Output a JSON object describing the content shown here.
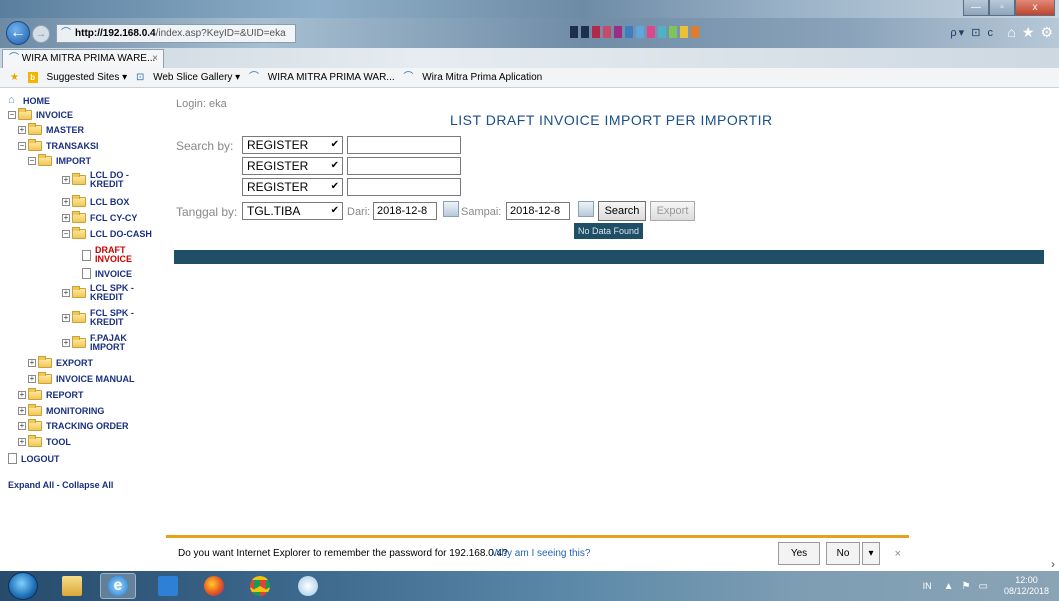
{
  "browser": {
    "url_host": "http://192.168.0.4",
    "url_path": "/index.asp?KeyID=&UID=eka",
    "search_icons": "ρ▾ ⊡ c",
    "tab_title": "WIRA MITRA PRIMA WARE...",
    "tab_close": "×",
    "win_min": "—",
    "win_max": "▫",
    "win_close": "x",
    "favorites": {
      "suggested": "Suggested Sites ▾",
      "web_slice": "Web Slice Gallery ▾",
      "fav1": "WIRA MITRA PRIMA WAR...",
      "fav2": "Wira Mitra Prima Aplication"
    }
  },
  "sidebar": {
    "home": "HOME",
    "invoice": "INVOICE",
    "master": "MASTER",
    "transaksi": "TRANSAKSI",
    "import": "IMPORT",
    "lcl_do_kredit_1": "LCL DO -",
    "lcl_do_kredit_2": "KREDIT",
    "lcl_box": "LCL BOX",
    "fcl_cy_cy": "FCL CY-CY",
    "lcl_do_cash": "LCL DO-CASH",
    "draft_invoice_1": "DRAFT",
    "draft_invoice_2": "INVOICE",
    "invoice_leaf": "INVOICE",
    "lcl_spk_1": "LCL SPK -",
    "lcl_spk_2": "KREDIT",
    "fcl_spk_1": "FCL SPK -",
    "fcl_spk_2": "KREDIT",
    "fpajak_1": "F.PAJAK",
    "fpajak_2": "IMPORT",
    "export": "EXPORT",
    "invoice_manual": "INVOICE MANUAL",
    "report": "REPORT",
    "monitoring": "MONITORING",
    "tracking_order": "TRACKING ORDER",
    "tool": "TOOL",
    "logout": "LOGOUT",
    "expand_collapse": "Expand All - Collapse All"
  },
  "main": {
    "login": "Login: eka",
    "title": "LIST DRAFT INVOICE IMPORT PER IMPORTIR",
    "search_by_label": "Search by:",
    "search_fields": [
      "REGISTER",
      "REGISTER",
      "REGISTER"
    ],
    "tanggal_label": "Tanggal by:",
    "tanggal_value": "TGL.TIBA",
    "dari_label": "Dari:",
    "dari_value": "2018-12-8",
    "sampai_label": "Sampai:",
    "sampai_value": "2018-12-8",
    "search_button": "Search",
    "export_button": "Export",
    "no_data": "No Data Found"
  },
  "notification": {
    "message": "Do you want Internet Explorer to remember the password for 192.168.0.4?",
    "why_link": "Why am I seeing this?",
    "yes": "Yes",
    "no": "No",
    "dropdown": "▾",
    "close": "×"
  },
  "taskbar": {
    "lang": "IN",
    "tray_arrow": "▲",
    "time": "12:00",
    "date": "08/12/2018"
  }
}
